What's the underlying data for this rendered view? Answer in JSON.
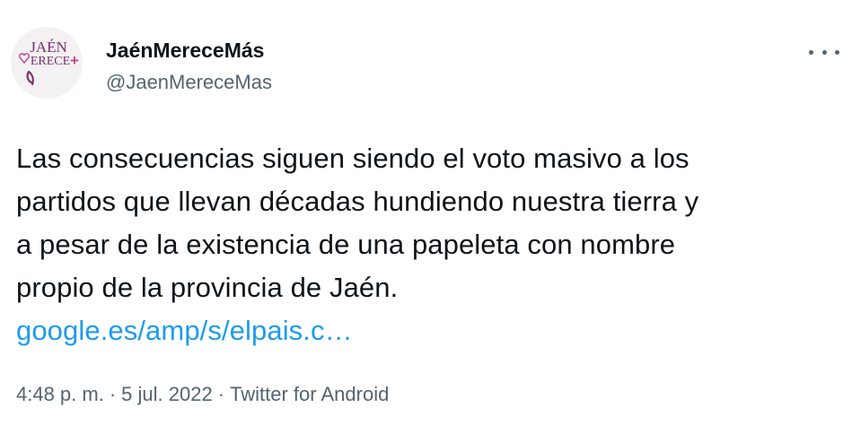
{
  "author": {
    "display_name": "JaénMereceMás",
    "handle": "@JaenMereceMas",
    "avatar_logo_text": "JAÉN MERECE+"
  },
  "tweet": {
    "text_lines": [
      "Las consecuencias siguen siendo el voto masivo a los",
      "partidos que llevan décadas hundiendo nuestra tierra y",
      "a pesar de la existencia de una papeleta con nombre",
      "propio de la provincia de Jaén."
    ],
    "link_text": "google.es/amp/s/elpais.c…",
    "time": "4:48 p. m.",
    "separator": "·",
    "date": "5 jul. 2022",
    "source": "Twitter for Android"
  },
  "icons": {
    "more": "more-horizontal-icon"
  },
  "colors": {
    "text": "#0f1419",
    "secondary": "#536471",
    "link": "#1d9bf0",
    "logo_purple": "#7a2e6e",
    "logo_pink": "#c7418e"
  }
}
